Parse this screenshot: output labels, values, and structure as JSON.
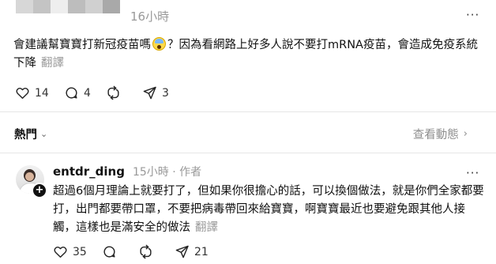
{
  "post": {
    "time": "16小時",
    "more_label": "···",
    "text": "會建議幫寶寶打新冠疫苗嗎",
    "text_after_emoji": "？因為看網路上好多人說不要打mRNA疫苗，會造成免疫系統下降",
    "emoji_name": "fearful-face-emoji",
    "translate_label": "翻譯",
    "likes": "14",
    "comments": "4",
    "reposts": "",
    "shares": "3"
  },
  "replies_bar": {
    "sort_label": "熱門",
    "activity_label": "查看動態"
  },
  "reply": {
    "username": "entdr_ding",
    "time": "15小時",
    "separator": "·",
    "author_tag": "作者",
    "more_label": "···",
    "text": "超過6個月理論上就要打了，但如果你很擔心的話，可以換個做法，就是你們全家都要打，出門都要帶口罩，不要把病毒帶回來給寶寶，啊寶寶最近也要避免跟其他人接觸，這樣也是滿安全的做法",
    "translate_label": "翻譯",
    "likes": "35",
    "comments": "",
    "reposts": "",
    "shares": "21"
  },
  "colors": {
    "text": "#101010",
    "muted": "#999999",
    "divider": "#e6e6e6"
  }
}
